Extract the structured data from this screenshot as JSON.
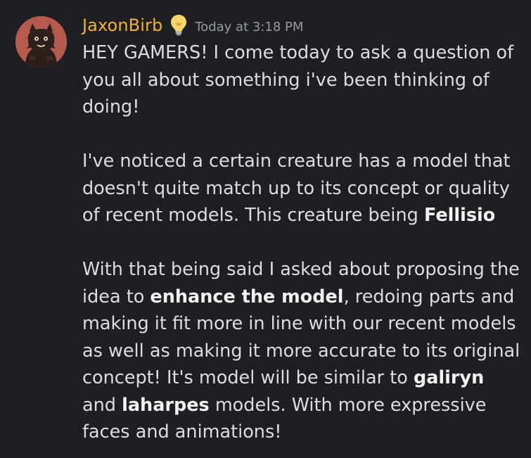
{
  "message": {
    "author": "JaxonBirb",
    "author_color": "#f0b232",
    "badge_icon": "lightbulb-icon",
    "timestamp": "Today at 3:18 PM",
    "paragraph1": "HEY GAMERS! I come today to ask a question of you all about something i've been thinking of doing!",
    "paragraph2": {
      "text": "I've noticed a certain creature has a model that doesn't quite match up to its concept or quality of recent models. This creature being ",
      "bold": "Fellisio"
    },
    "paragraph3": {
      "part1": "With that being said I asked about proposing the idea to ",
      "bold1": "enhance the model",
      "part2": ", redoing parts and making it fit more in line with our recent models as well as making it more accurate to its original concept! It's model will be similar to ",
      "bold2": "galiryn",
      "part3": " and ",
      "bold3": "laharpes",
      "part4": " models. With more expressive faces and animations!"
    }
  }
}
